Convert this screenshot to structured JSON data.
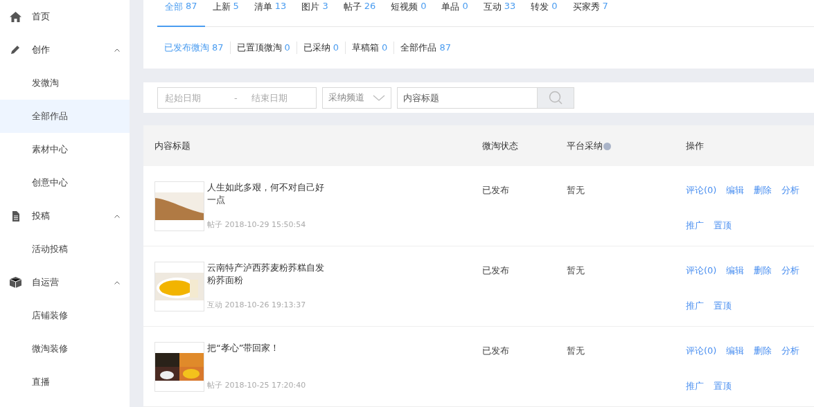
{
  "sidebar": {
    "items": [
      {
        "label": "首页",
        "kind": "home"
      },
      {
        "label": "创作",
        "kind": "pen",
        "expanded": true,
        "children": [
          {
            "label": "发微淘",
            "selected": false
          },
          {
            "label": "全部作品",
            "selected": true
          },
          {
            "label": "素材中心",
            "selected": false
          },
          {
            "label": "创意中心",
            "selected": false
          }
        ]
      },
      {
        "label": "投稿",
        "kind": "file",
        "expanded": true,
        "children": [
          {
            "label": "活动投稿",
            "selected": false
          }
        ]
      },
      {
        "label": "自运营",
        "kind": "cube",
        "expanded": true,
        "children": [
          {
            "label": "店铺装修",
            "selected": false
          },
          {
            "label": "微淘装修",
            "selected": false
          },
          {
            "label": "直播",
            "selected": false
          }
        ]
      }
    ]
  },
  "tabs": [
    {
      "label": "全部",
      "count": "87",
      "selected": true
    },
    {
      "label": "上新",
      "count": "5",
      "selected": false
    },
    {
      "label": "清单",
      "count": "13",
      "selected": false
    },
    {
      "label": "图片",
      "count": "3",
      "selected": false
    },
    {
      "label": "帖子",
      "count": "26",
      "selected": false
    },
    {
      "label": "短视频",
      "count": "0",
      "selected": false
    },
    {
      "label": "单品",
      "count": "0",
      "selected": false
    },
    {
      "label": "互动",
      "count": "33",
      "selected": false
    },
    {
      "label": "转发",
      "count": "0",
      "selected": false
    },
    {
      "label": "买家秀",
      "count": "7",
      "selected": false
    }
  ],
  "sub_tabs": [
    {
      "label": "已发布微淘",
      "count": "87",
      "selected": true
    },
    {
      "label": "已置顶微淘",
      "count": "0",
      "selected": false
    },
    {
      "label": "已采纳",
      "count": "0",
      "selected": false
    },
    {
      "label": "草稿箱",
      "count": "0",
      "selected": false
    },
    {
      "label": "全部作品",
      "count": "87",
      "selected": false
    }
  ],
  "filters": {
    "start_date": {
      "placeholder": "起始日期"
    },
    "separator": "-",
    "end_date": {
      "placeholder": "结束日期"
    },
    "channel": {
      "placeholder": "采纳频道"
    },
    "title": {
      "placeholder": "内容标题"
    }
  },
  "table": {
    "columns": [
      "内容标题",
      "微淘状态",
      "平台采纳",
      "操作"
    ],
    "rows": [
      {
        "title": "人生如此多艰，何不对自己好一点",
        "meta": "帖子 2018-10-29 15:50:54",
        "status": "已发布",
        "adoption": "暂无",
        "actions": [
          "评论(0)",
          "编辑",
          "删除",
          "分析",
          "推广",
          "置顶"
        ]
      },
      {
        "title": "云南特产泸西荞麦粉荞糕自发粉荞面粉",
        "meta": "互动 2018-10-26 19:13:37",
        "status": "已发布",
        "adoption": "暂无",
        "actions": [
          "评论(0)",
          "编辑",
          "删除",
          "分析",
          "推广",
          "置顶"
        ]
      },
      {
        "title": "把“孝心”带回家！",
        "meta": "帖子 2018-10-25 17:20:40",
        "status": "已发布",
        "adoption": "暂无",
        "actions": [
          "评论(0)",
          "编辑",
          "删除",
          "分析",
          "推广",
          "置顶"
        ]
      }
    ]
  }
}
